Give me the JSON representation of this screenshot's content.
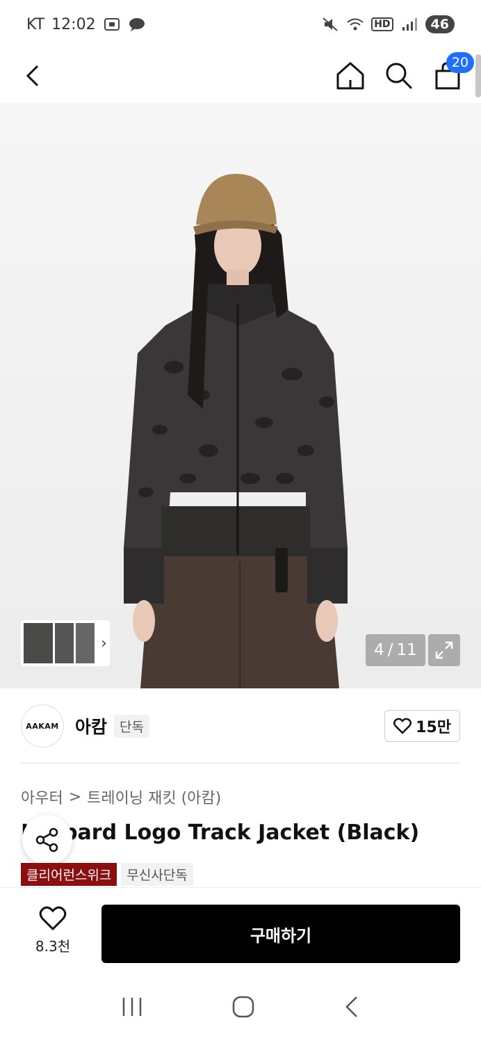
{
  "status": {
    "carrier": "KT",
    "time": "12:02",
    "network": "HD",
    "battery": "46"
  },
  "cart": {
    "count": "20"
  },
  "gallery": {
    "page_current": "4",
    "page_separator": "/",
    "page_total": "11"
  },
  "brand": {
    "logo_text": "AAKAM",
    "name": "아캄",
    "tag": "단독",
    "likes": "15만"
  },
  "breadcrumb": {
    "category": "아우터",
    "separator": ">",
    "subcategory": "트레이닝 재킷 (아캄)"
  },
  "product": {
    "title": "Leopard Logo Track Jacket (Black)",
    "badges": [
      "클리어런스위크",
      "무신사단독"
    ]
  },
  "bottom": {
    "wish_count": "8.3천",
    "buy_label": "구매하기"
  },
  "colors": {
    "accent_blue": "#1f6fff",
    "badge_red": "#8b0f0f",
    "buy_button": "#000000"
  }
}
